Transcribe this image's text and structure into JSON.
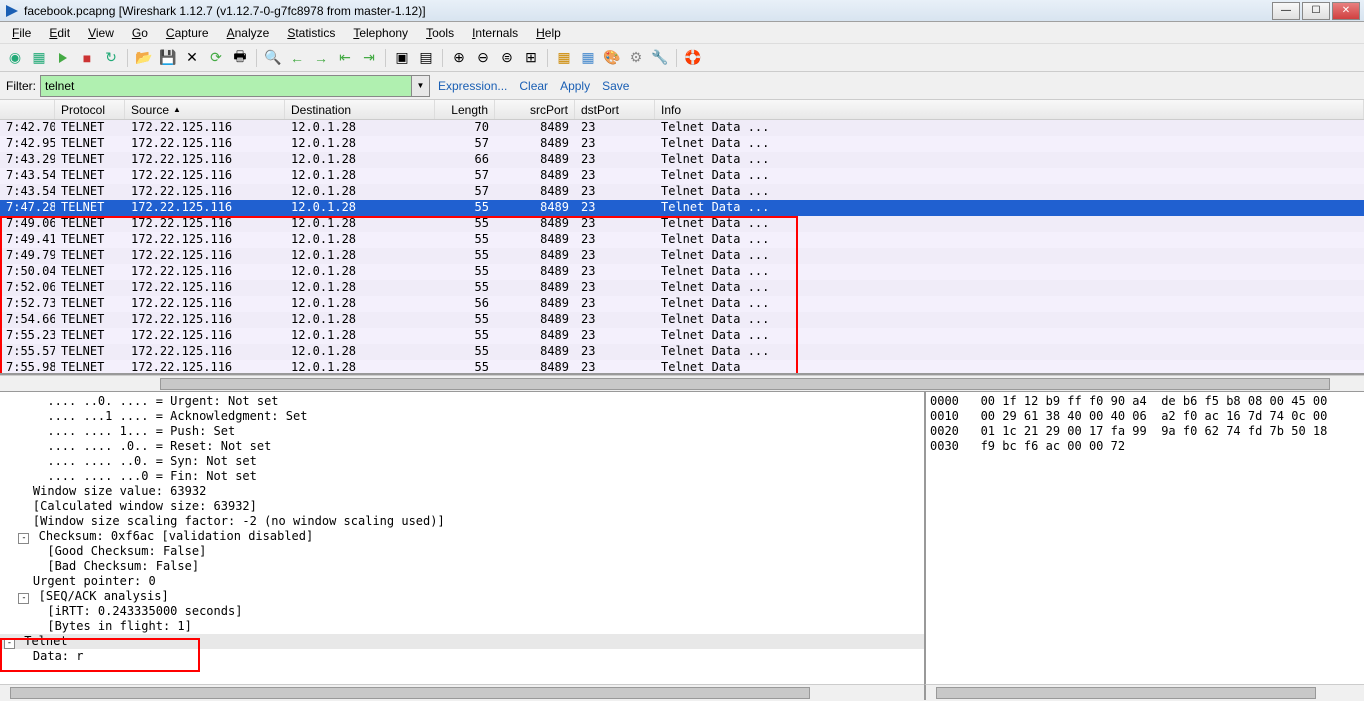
{
  "title": "facebook.pcapng   [Wireshark 1.12.7  (v1.12.7-0-g7fc8978 from master-1.12)]",
  "menu": [
    "File",
    "Edit",
    "View",
    "Go",
    "Capture",
    "Analyze",
    "Statistics",
    "Telephony",
    "Tools",
    "Internals",
    "Help"
  ],
  "filter": {
    "label": "Filter:",
    "value": "telnet",
    "links": [
      "Expression...",
      "Clear",
      "Apply",
      "Save"
    ]
  },
  "columns": {
    "protocol": "Protocol",
    "source": "Source",
    "destination": "Destination",
    "length": "Length",
    "srcPort": "srcPort",
    "dstPort": "dstPort",
    "info": "Info"
  },
  "packets": [
    {
      "time": "7:42.70",
      "proto": "TELNET",
      "src": "172.22.125.116",
      "dst": "12.0.1.28",
      "len": "70",
      "sp": "8489",
      "dp": "23",
      "info": "Telnet Data ...",
      "sel": false
    },
    {
      "time": "7:42.95",
      "proto": "TELNET",
      "src": "172.22.125.116",
      "dst": "12.0.1.28",
      "len": "57",
      "sp": "8489",
      "dp": "23",
      "info": "Telnet Data ...",
      "sel": false
    },
    {
      "time": "7:43.29",
      "proto": "TELNET",
      "src": "172.22.125.116",
      "dst": "12.0.1.28",
      "len": "66",
      "sp": "8489",
      "dp": "23",
      "info": "Telnet Data ...",
      "sel": false
    },
    {
      "time": "7:43.54",
      "proto": "TELNET",
      "src": "172.22.125.116",
      "dst": "12.0.1.28",
      "len": "57",
      "sp": "8489",
      "dp": "23",
      "info": "Telnet Data ...",
      "sel": false
    },
    {
      "time": "7:43.54",
      "proto": "TELNET",
      "src": "172.22.125.116",
      "dst": "12.0.1.28",
      "len": "57",
      "sp": "8489",
      "dp": "23",
      "info": "Telnet Data ...",
      "sel": false
    },
    {
      "time": "7:47.28",
      "proto": "TELNET",
      "src": "172.22.125.116",
      "dst": "12.0.1.28",
      "len": "55",
      "sp": "8489",
      "dp": "23",
      "info": "Telnet Data ...",
      "sel": true
    },
    {
      "time": "7:49.06",
      "proto": "TELNET",
      "src": "172.22.125.116",
      "dst": "12.0.1.28",
      "len": "55",
      "sp": "8489",
      "dp": "23",
      "info": "Telnet Data ...",
      "sel": false
    },
    {
      "time": "7:49.41",
      "proto": "TELNET",
      "src": "172.22.125.116",
      "dst": "12.0.1.28",
      "len": "55",
      "sp": "8489",
      "dp": "23",
      "info": "Telnet Data ...",
      "sel": false
    },
    {
      "time": "7:49.79",
      "proto": "TELNET",
      "src": "172.22.125.116",
      "dst": "12.0.1.28",
      "len": "55",
      "sp": "8489",
      "dp": "23",
      "info": "Telnet Data ...",
      "sel": false
    },
    {
      "time": "7:50.04",
      "proto": "TELNET",
      "src": "172.22.125.116",
      "dst": "12.0.1.28",
      "len": "55",
      "sp": "8489",
      "dp": "23",
      "info": "Telnet Data ...",
      "sel": false
    },
    {
      "time": "7:52.06",
      "proto": "TELNET",
      "src": "172.22.125.116",
      "dst": "12.0.1.28",
      "len": "55",
      "sp": "8489",
      "dp": "23",
      "info": "Telnet Data ...",
      "sel": false
    },
    {
      "time": "7:52.73",
      "proto": "TELNET",
      "src": "172.22.125.116",
      "dst": "12.0.1.28",
      "len": "56",
      "sp": "8489",
      "dp": "23",
      "info": "Telnet Data ...",
      "sel": false
    },
    {
      "time": "7:54.66",
      "proto": "TELNET",
      "src": "172.22.125.116",
      "dst": "12.0.1.28",
      "len": "55",
      "sp": "8489",
      "dp": "23",
      "info": "Telnet Data ...",
      "sel": false
    },
    {
      "time": "7:55.23",
      "proto": "TELNET",
      "src": "172.22.125.116",
      "dst": "12.0.1.28",
      "len": "55",
      "sp": "8489",
      "dp": "23",
      "info": "Telnet Data ...",
      "sel": false
    },
    {
      "time": "7:55.57",
      "proto": "TELNET",
      "src": "172.22.125.116",
      "dst": "12.0.1.28",
      "len": "55",
      "sp": "8489",
      "dp": "23",
      "info": "Telnet Data ...",
      "sel": false
    },
    {
      "time": "7:55.98",
      "proto": "TELNET",
      "src": "172.22.125.116",
      "dst": "12.0.1.28",
      "len": "55",
      "sp": "8489",
      "dp": "23",
      "info": "Telnet Data",
      "sel": false
    }
  ],
  "tree": [
    {
      "indent": 3,
      "exp": null,
      "text": ".... ..0. .... = Urgent: Not set"
    },
    {
      "indent": 3,
      "exp": null,
      "text": ".... ...1 .... = Acknowledgment: Set"
    },
    {
      "indent": 3,
      "exp": null,
      "text": ".... .... 1... = Push: Set"
    },
    {
      "indent": 3,
      "exp": null,
      "text": ".... .... .0.. = Reset: Not set"
    },
    {
      "indent": 3,
      "exp": null,
      "text": ".... .... ..0. = Syn: Not set"
    },
    {
      "indent": 3,
      "exp": null,
      "text": ".... .... ...0 = Fin: Not set"
    },
    {
      "indent": 2,
      "exp": null,
      "text": "Window size value: 63932"
    },
    {
      "indent": 2,
      "exp": null,
      "text": "[Calculated window size: 63932]"
    },
    {
      "indent": 2,
      "exp": null,
      "text": "[Window size scaling factor: -2 (no window scaling used)]"
    },
    {
      "indent": 1,
      "exp": "-",
      "text": "Checksum: 0xf6ac [validation disabled]"
    },
    {
      "indent": 3,
      "exp": null,
      "text": "[Good Checksum: False]"
    },
    {
      "indent": 3,
      "exp": null,
      "text": "[Bad Checksum: False]"
    },
    {
      "indent": 2,
      "exp": null,
      "text": "Urgent pointer: 0"
    },
    {
      "indent": 1,
      "exp": "-",
      "text": "[SEQ/ACK analysis]"
    },
    {
      "indent": 3,
      "exp": null,
      "text": "[iRTT: 0.243335000 seconds]"
    },
    {
      "indent": 3,
      "exp": null,
      "text": "[Bytes in flight: 1]"
    },
    {
      "indent": 0,
      "exp": "-",
      "text": "Telnet",
      "hl": true
    },
    {
      "indent": 2,
      "exp": null,
      "text": "Data: r"
    }
  ],
  "hex": [
    "0000   00 1f 12 b9 ff f0 90 a4  de b6 f5 b8 08 00 45 00",
    "0010   00 29 61 38 40 00 40 06  a2 f0 ac 16 7d 74 0c 00",
    "0020   01 1c 21 29 00 17 fa 99  9a f0 62 74 fd 7b 50 18",
    "0030   f9 bc f6 ac 00 00 72"
  ]
}
